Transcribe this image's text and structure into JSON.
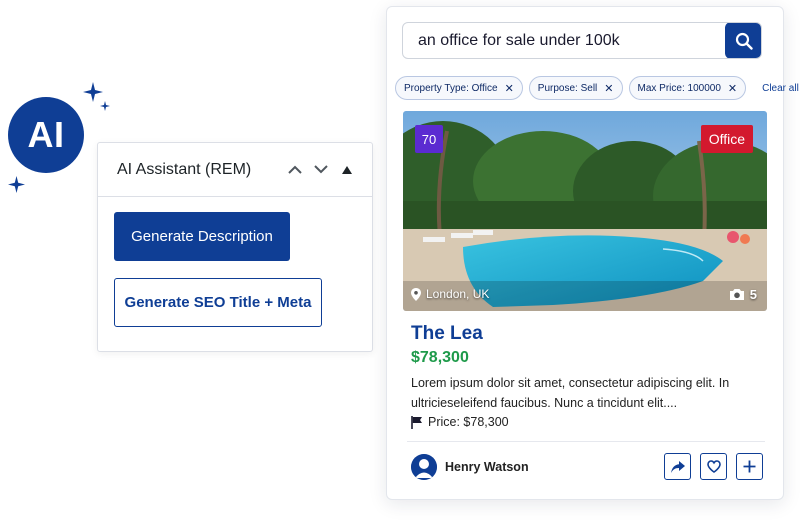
{
  "ai_badge": {
    "label": "AI"
  },
  "ai_panel": {
    "title": "AI Assistant (REM)",
    "generate_description_label": "Generate Description",
    "generate_seo_label": "Generate SEO Title + Meta"
  },
  "search": {
    "value": "an office for sale under 100k",
    "placeholder": ""
  },
  "filters": {
    "chips": [
      {
        "label": "Property Type: Office"
      },
      {
        "label": "Purpose: Sell"
      },
      {
        "label": "Max Price: 100000"
      }
    ],
    "clear_all_label": "Clear all"
  },
  "listing": {
    "badge_number": "70",
    "badge_type": "Office",
    "location": "London, UK",
    "photo_count": "5",
    "title": "The Lea",
    "price": "$78,300",
    "description": "Lorem ipsum dolor sit amet, consectetur adipiscing elit. In ultricieseleifend faucibus. Nunc a tincidunt elit....",
    "meta_price": "Price: $78,300",
    "agent_name": "Henry Watson"
  },
  "colors": {
    "brand_navy": "#0f3e95",
    "price_green": "#1e9a4a",
    "badge_purple": "#5b2bd1",
    "badge_red": "#d3192e"
  },
  "icons": [
    "sparkle-icon",
    "chevron-up-icon",
    "chevron-down-icon",
    "triangle-up-icon",
    "search-icon",
    "close-icon",
    "map-pin-icon",
    "camera-icon",
    "flag-icon",
    "share-icon",
    "heart-icon",
    "plus-icon"
  ]
}
